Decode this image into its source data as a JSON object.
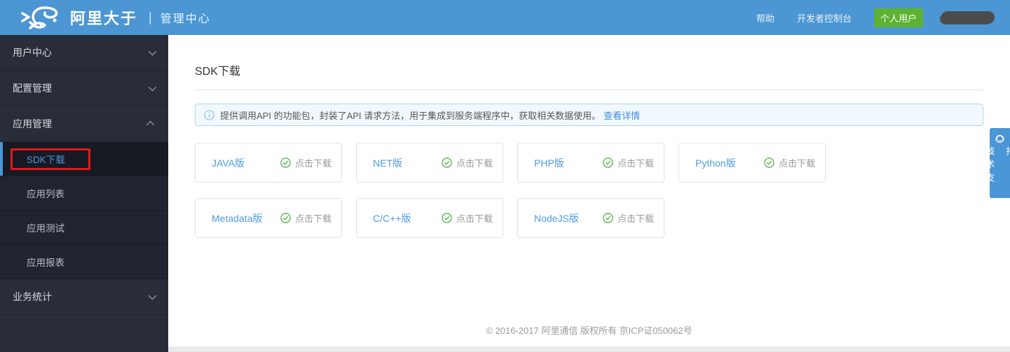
{
  "header": {
    "brand": "阿里大于",
    "subtitle": "管理中心",
    "separator": "|",
    "links": [
      {
        "label": "帮助"
      },
      {
        "label": "开发者控制台"
      }
    ],
    "user_badge": "个人用户"
  },
  "sidebar": {
    "items": [
      {
        "label": "用户中心",
        "state": "collapsed"
      },
      {
        "label": "配置管理",
        "state": "collapsed"
      },
      {
        "label": "应用管理",
        "state": "expanded",
        "children": [
          {
            "label": "SDK下载",
            "selected": true
          },
          {
            "label": "应用列表"
          },
          {
            "label": "应用测试"
          },
          {
            "label": "应用报表"
          }
        ]
      },
      {
        "label": "业务统计",
        "state": "collapsed"
      }
    ]
  },
  "main": {
    "title": "SDK下载",
    "banner": {
      "text": "提供调用API 的功能包，封装了API 请求方法，用于集成到服务端程序中，获取相关数据使用。",
      "link": "查看详情"
    },
    "cards": [
      {
        "name": "JAVA版",
        "action": "点击下载"
      },
      {
        "name": "NET版",
        "action": "点击下载"
      },
      {
        "name": "PHP版",
        "action": "点击下载"
      },
      {
        "name": "Python版",
        "action": "点击下载"
      },
      {
        "name": "Metadata版",
        "action": "点击下载"
      },
      {
        "name": "C/C++版",
        "action": "点击下载"
      },
      {
        "name": "NodeJS版",
        "action": "点击下载"
      }
    ],
    "footer": "© 2016-2017 阿里通信 版权所有 京ICP证050062号"
  },
  "support_widget": {
    "label": "技术支持"
  },
  "colors": {
    "header_blue": "#4b96d3",
    "sidebar_dark": "#282d39",
    "accent_blue": "#4a96d6",
    "badge_green": "#5db231",
    "check_green": "#52b548",
    "link_blue": "#3e8ddd",
    "annotation_red": "#e11919"
  }
}
